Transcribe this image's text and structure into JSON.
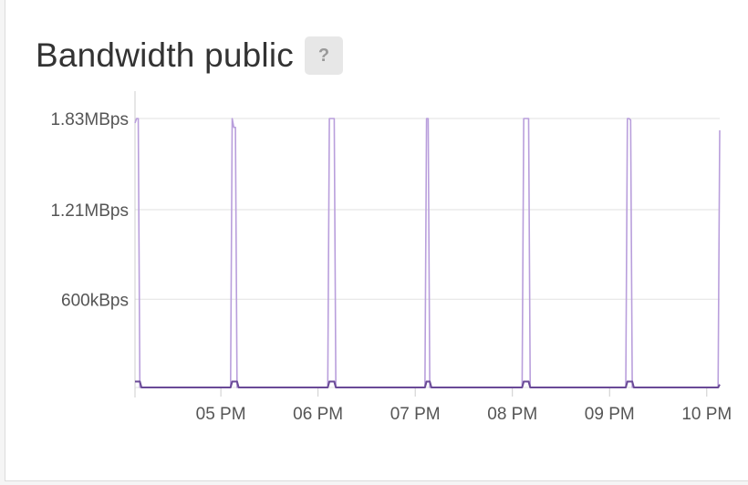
{
  "widget": {
    "title": "Bandwidth public",
    "help_label": "?"
  },
  "colors": {
    "series_main": "#b99fdc",
    "series_low": "#6a4a97",
    "grid": "#e2e2e2",
    "axis": "#cccccc"
  },
  "chart_data": {
    "type": "line",
    "title": "Bandwidth public",
    "xlabel": "",
    "ylabel": "",
    "y_ticks": [
      {
        "value": 1.83,
        "label": "1.83MBps"
      },
      {
        "value": 1.21,
        "label": "1.21MBps"
      },
      {
        "value": 0.6,
        "label": "600kBps"
      }
    ],
    "ylim": [
      0,
      1.83
    ],
    "y_unit": "MBps",
    "x_ticks": [
      {
        "time": "17:00",
        "label": "05 PM"
      },
      {
        "time": "18:00",
        "label": "06 PM"
      },
      {
        "time": "19:00",
        "label": "07 PM"
      },
      {
        "time": "20:00",
        "label": "08 PM"
      },
      {
        "time": "21:00",
        "label": "09 PM"
      },
      {
        "time": "22:00",
        "label": "10 PM"
      }
    ],
    "xlim": [
      "16:07",
      "22:08"
    ],
    "grid": true,
    "series": [
      {
        "color": "#b99fdc",
        "points": [
          [
            "16:07",
            1.8
          ],
          [
            "16:08",
            1.83
          ],
          [
            "16:09",
            1.83
          ],
          [
            "16:10",
            0.0
          ],
          [
            "17:06",
            0.0
          ],
          [
            "17:07",
            1.83
          ],
          [
            "17:08",
            1.77
          ],
          [
            "17:09",
            1.77
          ],
          [
            "17:10",
            0.0
          ],
          [
            "18:06",
            0.0
          ],
          [
            "18:07",
            1.83
          ],
          [
            "18:08",
            1.83
          ],
          [
            "18:10",
            1.83
          ],
          [
            "18:11",
            0.0
          ],
          [
            "19:06",
            0.0
          ],
          [
            "19:07",
            1.83
          ],
          [
            "19:08",
            1.83
          ],
          [
            "19:09",
            0.0
          ],
          [
            "20:06",
            0.0
          ],
          [
            "20:07",
            1.83
          ],
          [
            "20:08",
            1.83
          ],
          [
            "20:10",
            1.83
          ],
          [
            "20:11",
            0.0
          ],
          [
            "21:10",
            0.0
          ],
          [
            "21:11",
            1.83
          ],
          [
            "21:12",
            1.83
          ],
          [
            "21:13",
            1.82
          ],
          [
            "21:14",
            0.0
          ],
          [
            "22:07",
            0.0
          ],
          [
            "22:08",
            1.75
          ]
        ]
      },
      {
        "color": "#6a4a97",
        "points": [
          [
            "16:07",
            0.04
          ],
          [
            "16:10",
            0.04
          ],
          [
            "16:11",
            0.0
          ],
          [
            "17:06",
            0.0
          ],
          [
            "17:07",
            0.04
          ],
          [
            "17:10",
            0.04
          ],
          [
            "17:11",
            0.0
          ],
          [
            "18:06",
            0.0
          ],
          [
            "18:07",
            0.04
          ],
          [
            "18:10",
            0.04
          ],
          [
            "18:11",
            0.0
          ],
          [
            "19:06",
            0.0
          ],
          [
            "19:07",
            0.04
          ],
          [
            "19:09",
            0.04
          ],
          [
            "19:10",
            0.0
          ],
          [
            "20:06",
            0.0
          ],
          [
            "20:07",
            0.04
          ],
          [
            "20:10",
            0.04
          ],
          [
            "20:11",
            0.0
          ],
          [
            "21:10",
            0.0
          ],
          [
            "21:11",
            0.04
          ],
          [
            "21:14",
            0.04
          ],
          [
            "21:15",
            0.0
          ],
          [
            "22:07",
            0.0
          ],
          [
            "22:08",
            0.02
          ]
        ]
      }
    ]
  }
}
